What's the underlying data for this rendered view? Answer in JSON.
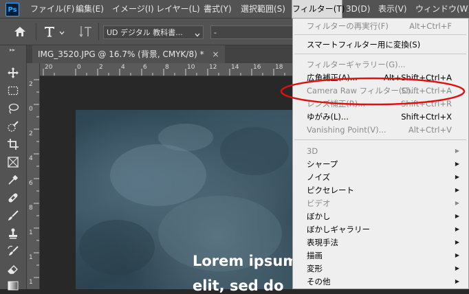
{
  "app": {
    "logo": "Ps"
  },
  "menubar": {
    "items": [
      "ファイル(F)",
      "編集(E)",
      "イメージ(I)",
      "レイヤー(L)",
      "書式(Y)",
      "選択範囲(S)",
      "フィルター(T)",
      "3D(D)",
      "表示(V)",
      "ウィンドウ(W)"
    ],
    "active_index": 6
  },
  "options_bar": {
    "font_family": "UD デジタル 教科書...",
    "font_style": "-"
  },
  "document_tab": {
    "title": "IMG_3520.JPG @ 16.7% (背景, CMYK/8) *",
    "close": "×"
  },
  "rulers": {
    "top": [
      "20",
      "0",
      "2",
      "4",
      "6",
      "8",
      "10",
      "12",
      "14",
      "16",
      "18",
      "20"
    ],
    "left": [
      "2",
      "0",
      "2",
      "4",
      "6",
      "8",
      "1",
      "1",
      "1"
    ]
  },
  "canvas_text": {
    "line1": "Lorem ipsum",
    "line2": "elit, sed do"
  },
  "filter_menu": {
    "items": [
      {
        "label": "フィルターの再実行(F)",
        "shortcut": "Alt+Ctrl+F",
        "disabled": true
      },
      {
        "label": "スマートフィルター用に変換(S)",
        "shortcut": "",
        "disabled": false
      },
      {
        "label": "フィルターギャラリー(G)...",
        "shortcut": "",
        "disabled": true
      },
      {
        "label": "広角補正(A)...",
        "shortcut": "Alt+Shift+Ctrl+A",
        "disabled": false
      },
      {
        "label": "Camera Raw フィルター(C)...",
        "shortcut": "Shift+Ctrl+A",
        "disabled": true
      },
      {
        "label": "レンズ補正(R)...",
        "shortcut": "Shift+Ctrl+R",
        "disabled": true
      },
      {
        "label": "ゆがみ(L)...",
        "shortcut": "Shift+Ctrl+X",
        "disabled": false
      },
      {
        "label": "Vanishing Point(V)...",
        "shortcut": "Alt+Ctrl+V",
        "disabled": true
      },
      {
        "label": "3D",
        "submenu": true,
        "disabled": true
      },
      {
        "label": "シャープ",
        "submenu": true,
        "disabled": false
      },
      {
        "label": "ノイズ",
        "submenu": true,
        "disabled": false
      },
      {
        "label": "ピクセレート",
        "submenu": true,
        "disabled": false
      },
      {
        "label": "ビデオ",
        "submenu": true,
        "disabled": true
      },
      {
        "label": "ぼかし",
        "submenu": true,
        "disabled": false
      },
      {
        "label": "ぼかしギャラリー",
        "submenu": true,
        "disabled": false
      },
      {
        "label": "表現手法",
        "submenu": true,
        "disabled": false
      },
      {
        "label": "描画",
        "submenu": true,
        "disabled": false
      },
      {
        "label": "変形",
        "submenu": true,
        "disabled": false
      },
      {
        "label": "その他",
        "submenu": true,
        "disabled": false
      }
    ],
    "submenu_arrow": "▶"
  },
  "colors": {
    "highlight_ellipse": "#e01010",
    "ui_panel": "#535353",
    "menu_bg": "#efefef"
  }
}
